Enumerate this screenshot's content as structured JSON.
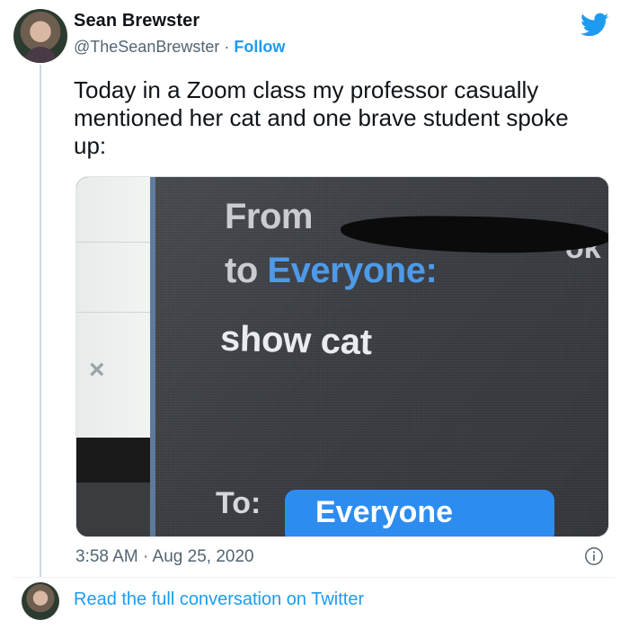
{
  "tweet": {
    "author_name": "Sean Brewster",
    "handle": "@TheSeanBrewster",
    "separator": "·",
    "follow_label": "Follow",
    "text": "Today in a Zoom class my professor casually mentioned her cat and one brave student spoke up:",
    "timestamp": "3:58 AM · Aug 25, 2020",
    "read_more_label": "Read the full conversation on Twitter"
  },
  "media": {
    "from_label": "From",
    "name_tail": "ok",
    "to_prefix": "to",
    "to_target": "Everyone:",
    "message": "show cat",
    "to_field_label": "To:",
    "to_field_value": "Everyone",
    "close_glyph": "×"
  },
  "colors": {
    "link": "#1d9bf0",
    "zoom_blue": "#2d8cf0"
  }
}
